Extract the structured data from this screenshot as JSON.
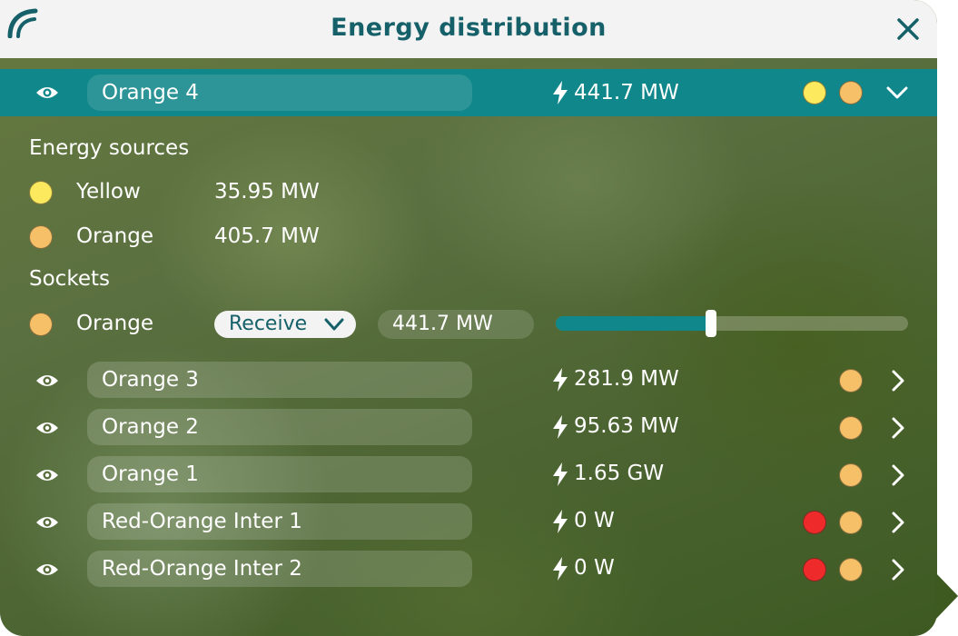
{
  "window": {
    "title": "Energy distribution",
    "logo_icon": "app-logo-icon",
    "close_icon": "close-icon"
  },
  "selected": {
    "name": "Orange 4",
    "power": "441.7 MW",
    "dots": [
      "#fde95e",
      "#f6c068"
    ],
    "expand_icon": "chevron-down-icon"
  },
  "energy_sources": {
    "label": "Energy sources",
    "items": [
      {
        "name": "Yellow",
        "value": "35.95 MW",
        "color": "#fde95e"
      },
      {
        "name": "Orange",
        "value": "405.7 MW",
        "color": "#f6c068"
      }
    ]
  },
  "sockets": {
    "label": "Sockets",
    "items": [
      {
        "name": "Orange",
        "color": "#f6c068",
        "mode": "Receive",
        "value": "441.7 MW",
        "slider_fraction": 0.44
      }
    ]
  },
  "rows": [
    {
      "name": "Orange 3",
      "power": "281.9 MW",
      "dots": [
        "#f6c068"
      ]
    },
    {
      "name": "Orange 2",
      "power": "95.63 MW",
      "dots": [
        "#f6c068"
      ]
    },
    {
      "name": "Orange 1",
      "power": "1.65 GW",
      "dots": [
        "#f6c068"
      ]
    },
    {
      "name": "Red-Orange Inter 1",
      "power": "0 W",
      "dots": [
        "#ee2a2a",
        "#f6c068"
      ]
    },
    {
      "name": "Red-Orange Inter 2",
      "power": "0 W",
      "dots": [
        "#ee2a2a",
        "#f6c068"
      ]
    }
  ],
  "colors": {
    "accent": "#10878a",
    "title": "#16606a",
    "header_bg": "#f2f3f2"
  }
}
